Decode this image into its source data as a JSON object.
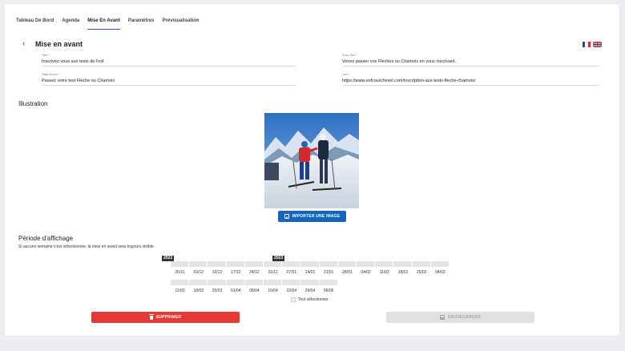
{
  "tabs": [
    {
      "label": "Tableau De Bord",
      "active": false
    },
    {
      "label": "Agenda",
      "active": false
    },
    {
      "label": "Mise En Avant",
      "active": true
    },
    {
      "label": "Paramètres",
      "active": false
    },
    {
      "label": "Prévisualisation",
      "active": false
    }
  ],
  "header": {
    "back_icon": "chevron-left-icon",
    "title": "Mise en avant"
  },
  "languages": [
    {
      "code": "fr",
      "icon": "flag-fr-icon"
    },
    {
      "code": "en",
      "icon": "flag-uk-icon"
    }
  ],
  "form": {
    "titre": {
      "label": "Titre *",
      "value": "Inscrivez-vous aux tests de l'esf"
    },
    "sous_titre": {
      "label": "Sous-Titre *",
      "value": "Venez passer vos Flèches ou Chamois en vous inscrivant."
    },
    "texte_bouton": {
      "label": "Texte bouton *",
      "value": "Passez votre test Flèche ou Chamois"
    },
    "lien": {
      "label": "Lien *",
      "value": "https://www.esfcourchevel.com/inscription-aux-tests-fleche-chamois/"
    }
  },
  "illustration": {
    "title": "Illustration",
    "import_label": "IMPORTER UNE IMAGE",
    "import_icon": "image-icon"
  },
  "periode": {
    "title": "Période d'affichage",
    "hint": "Si aucune semaine n'est sélectionnée, la mise en avant sera toujours visible.",
    "years": [
      "2022",
      "2023"
    ],
    "row1": [
      "26/11",
      "03/12",
      "10/12",
      "17/12",
      "24/12",
      "31/12",
      "07/01",
      "14/01",
      "21/01",
      "28/01",
      "04/02",
      "11/02",
      "18/02",
      "25/02",
      "04/03"
    ],
    "row2": [
      "11/03",
      "18/03",
      "25/03",
      "01/04",
      "08/04",
      "15/04",
      "22/04",
      "29/04",
      "06/05"
    ],
    "select_all": "Tout sélectionner"
  },
  "actions": {
    "delete_label": "SUPPRIMER",
    "delete_icon": "trash-icon",
    "save_label": "SAUVEGARDER",
    "save_icon": "save-icon"
  },
  "colors": {
    "accent": "#1565c0",
    "danger": "#e53935",
    "disabled": "#e0e0e0",
    "tab_underline": "#3f51b5"
  }
}
